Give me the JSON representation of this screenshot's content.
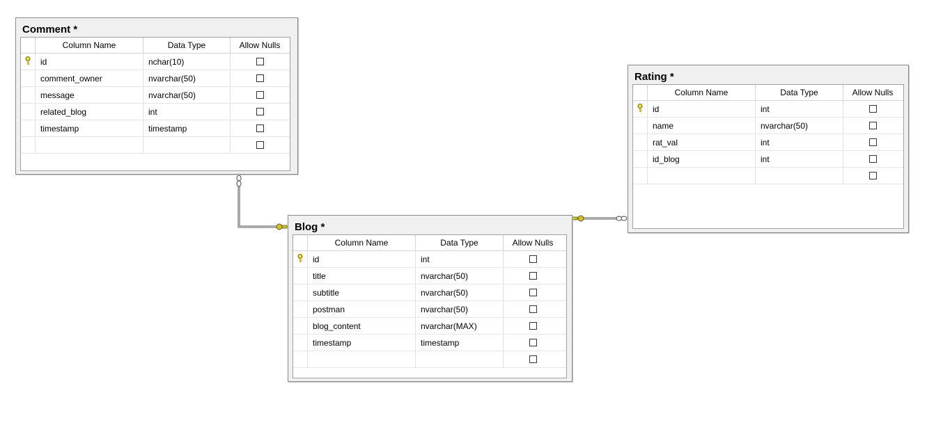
{
  "columns": {
    "name": "Column Name",
    "type": "Data Type",
    "nulls": "Allow Nulls"
  },
  "tables": {
    "comment": {
      "title": "Comment *",
      "rows": [
        {
          "name": "id",
          "type": "nchar(10)",
          "pk": true
        },
        {
          "name": "comment_owner",
          "type": "nvarchar(50)"
        },
        {
          "name": "message",
          "type": "nvarchar(50)"
        },
        {
          "name": "related_blog",
          "type": "int"
        },
        {
          "name": "timestamp",
          "type": "timestamp"
        },
        {
          "name": "",
          "type": ""
        }
      ]
    },
    "rating": {
      "title": "Rating *",
      "rows": [
        {
          "name": "id",
          "type": "int",
          "pk": true
        },
        {
          "name": "name",
          "type": "nvarchar(50)"
        },
        {
          "name": "rat_val",
          "type": "int"
        },
        {
          "name": "id_blog",
          "type": "int"
        },
        {
          "name": "",
          "type": ""
        }
      ]
    },
    "blog": {
      "title": "Blog *",
      "rows": [
        {
          "name": "id",
          "type": "int",
          "pk": true
        },
        {
          "name": "title",
          "type": "nvarchar(50)"
        },
        {
          "name": "subtitle",
          "type": "nvarchar(50)"
        },
        {
          "name": "postman",
          "type": "nvarchar(50)"
        },
        {
          "name": "blog_content",
          "type": "nvarchar(MAX)"
        },
        {
          "name": "timestamp",
          "type": "timestamp"
        },
        {
          "name": "",
          "type": ""
        }
      ]
    }
  },
  "colors": {
    "key": "#d8c300",
    "relationship": "#555555"
  }
}
